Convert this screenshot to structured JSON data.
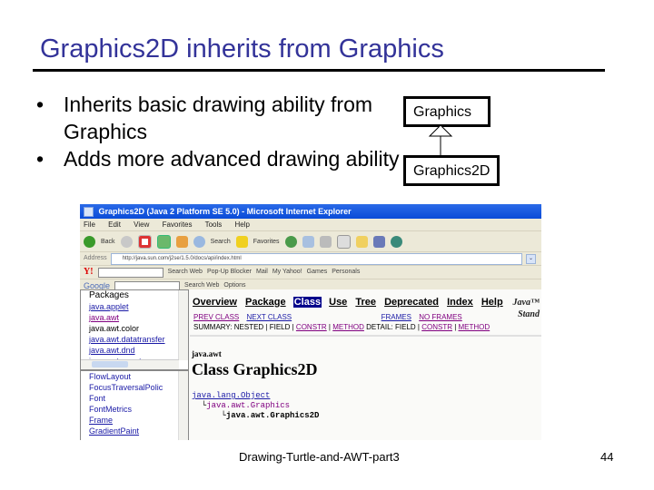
{
  "slide": {
    "title": "Graphics2D inherits from Graphics",
    "bullets": [
      "Inherits basic drawing ability from Graphics",
      "Adds more advanced drawing ability"
    ],
    "bullet_glyph": "•",
    "uml": {
      "parent": "Graphics",
      "child": "Graphics2D",
      "relation": "inheritance"
    },
    "footer": "Drawing-Turtle-and-AWT-part3",
    "page_number": "44"
  },
  "browser": {
    "window_title": "Graphics2D (Java 2 Platform SE 5.0) - Microsoft Internet Explorer",
    "menu": [
      "File",
      "Edit",
      "View",
      "Favorites",
      "Tools",
      "Help"
    ],
    "toolbar": {
      "back": "Back",
      "search": "Search",
      "favorites": "Favorites"
    },
    "address": {
      "label": "Address",
      "value": "http://java.sun.com/j2se/1.5.0/docs/api/index.html"
    },
    "yahoo_toolbar": {
      "logo": "Y!",
      "search_button": "Search Web",
      "items": [
        "Pop-Up Blocker",
        "Mail",
        "My Yahoo!",
        "Games",
        "Personals"
      ]
    },
    "google_toolbar": {
      "logo": "Google",
      "search_button": "Search Web",
      "items": [
        "Options"
      ]
    },
    "packages_frame": {
      "header": "Packages",
      "items": [
        {
          "label": "java.applet",
          "state": "link"
        },
        {
          "label": "java.awt",
          "state": "visited"
        },
        {
          "label": "java.awt.color",
          "state": "plain"
        },
        {
          "label": "java.awt.datatransfer",
          "state": "link"
        },
        {
          "label": "java.awt.dnd",
          "state": "link"
        },
        {
          "label": "java.awt.event",
          "state": "link"
        }
      ]
    },
    "classes_frame": {
      "items": [
        {
          "label": "FlowLayout",
          "underline": false
        },
        {
          "label": "FocusTraversalPolic",
          "underline": false
        },
        {
          "label": "Font",
          "underline": false
        },
        {
          "label": "FontMetrics",
          "underline": false
        },
        {
          "label": "Frame",
          "underline": true
        },
        {
          "label": "GradientPaint",
          "underline": true
        }
      ]
    },
    "doc": {
      "nav": [
        "Overview",
        "Package",
        "Class",
        "Use",
        "Tree",
        "Deprecated",
        "Index",
        "Help"
      ],
      "active_nav": "Class",
      "java_logo": [
        "Java™",
        "Stand"
      ],
      "prev_class": "PREV CLASS",
      "next_class": "NEXT CLASS",
      "frames": "FRAMES",
      "no_frames": "NO FRAMES",
      "summary_line": {
        "prefix": "SUMMARY: NESTED | FIELD | ",
        "constr": "CONSTR",
        "sep": " | ",
        "method": "METHOD"
      },
      "detail_line": {
        "prefix": "DETAIL: FIELD | ",
        "constr": "CONSTR",
        "sep": " | ",
        "method": "METHOD"
      },
      "package_name": "java.awt",
      "class_heading": "Class Graphics2D",
      "hierarchy": [
        "java.lang.Object",
        "java.awt.Graphics",
        "java.awt.Graphics2D"
      ]
    }
  }
}
